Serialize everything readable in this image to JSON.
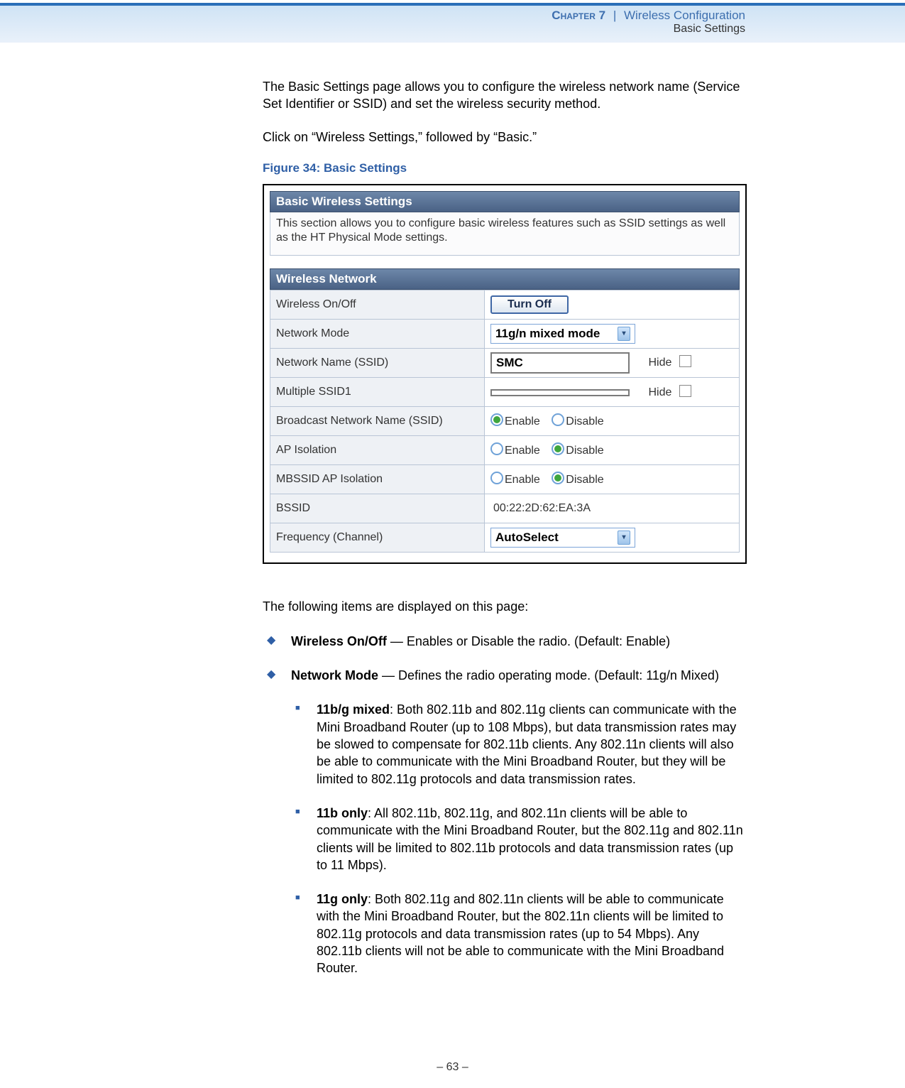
{
  "header": {
    "chapter": "Chapter 7",
    "section": "Wireless Configuration",
    "subline": "Basic Settings"
  },
  "intro1": "The Basic Settings page allows you to configure the wireless network name (Service Set Identifier or SSID) and set the wireless security method.",
  "intro2": "Click on “Wireless Settings,” followed by “Basic.”",
  "figure_caption": "Figure 34:  Basic Settings",
  "screenshot": {
    "panel1_title": "Basic Wireless Settings",
    "panel1_desc": "This section allows you to configure basic wireless features such as SSID settings as well as the HT Physical Mode settings.",
    "panel2_title": "Wireless Network",
    "rows": {
      "wireless_onoff_label": "Wireless On/Off",
      "turn_off_btn": "Turn Off",
      "network_mode_label": "Network Mode",
      "network_mode_value": "11g/n mixed mode",
      "ssid_label": "Network Name (SSID)",
      "ssid_value": "SMC",
      "hide1": "Hide",
      "mssid_label": "Multiple SSID1",
      "mssid_value": "",
      "hide2": "Hide",
      "broadcast_label": "Broadcast Network Name (SSID)",
      "enable": "Enable",
      "disable": "Disable",
      "apiso_label": "AP Isolation",
      "mbssid_label": "MBSSID AP Isolation",
      "bssid_label": "BSSID",
      "bssid_value": "00:22:2D:62:EA:3A",
      "freq_label": "Frequency (Channel)",
      "freq_value": "AutoSelect"
    }
  },
  "items_intro": "The following items are displayed on this page:",
  "items": [
    {
      "bold": "Wireless On/Off",
      "text": " — Enables or Disable the radio. (Default: Enable)"
    },
    {
      "bold": "Network Mode",
      "text": " — Defines the radio operating mode. (Default: 11g/n Mixed)"
    }
  ],
  "subitems": [
    {
      "bold": "11b/g mixed",
      "text": ": Both 802.11b and 802.11g clients can communicate with the Mini Broadband Router (up to 108 Mbps), but data transmission rates may be slowed to compensate for 802.11b clients. Any 802.11n clients will also be able to communicate with the Mini Broadband Router, but they will be limited to 802.11g protocols and data transmission rates."
    },
    {
      "bold": "11b only",
      "text": ": All 802.11b, 802.11g, and 802.11n clients will be able to communicate with the Mini Broadband Router, but the 802.11g and 802.11n clients will be limited to 802.11b protocols and data transmission rates (up to 11 Mbps)."
    },
    {
      "bold": "11g only",
      "text": ": Both 802.11g and 802.11n clients will be able to communicate with the Mini Broadband Router, but the 802.11n clients will be limited to 802.11g protocols and data transmission rates (up to 54 Mbps). Any 802.11b clients will not be able to communicate with the Mini Broadband Router."
    }
  ],
  "footer": "–  63  –"
}
